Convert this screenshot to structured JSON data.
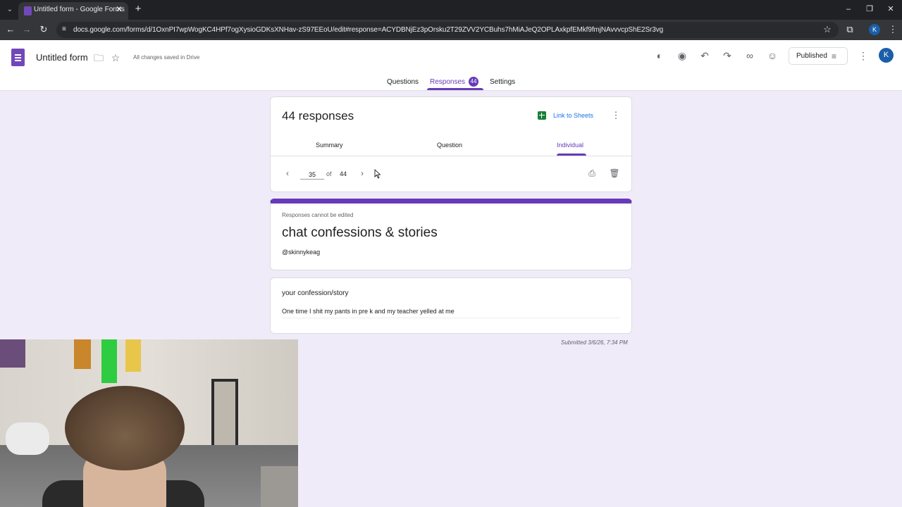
{
  "browser": {
    "tab_title": "Untitled form - Google Forms",
    "url": "docs.google.com/forms/d/1OxnPI7wpWogKC4HPf7ogXysioGDKsXNHav-zS97EEoU/edit#response=ACYDBNjEz3pOrsku2T29ZVV2YCBuhs7hMiAJeQ2OPLAxkpfEMkf9fmjNAvvvcpShE2Sr3vg",
    "profile_initial": "K"
  },
  "header": {
    "form_name": "Untitled form",
    "save_status": "All changes saved in Drive",
    "published_label": "Published",
    "avatar_initial": "K",
    "tabs": [
      {
        "label": "Questions"
      },
      {
        "label": "Responses"
      },
      {
        "label": "Settings"
      }
    ],
    "responses_count": "44"
  },
  "responses": {
    "count_label": "44 responses",
    "link_sheets": "Link to Sheets",
    "sub_tabs": [
      {
        "label": "Summary"
      },
      {
        "label": "Question"
      },
      {
        "label": "Individual"
      }
    ],
    "current_page": "35",
    "of_label": "of",
    "total": "44"
  },
  "form": {
    "notice": "Responses cannot be edited",
    "title": "chat confessions & stories",
    "description": "@skinnykeag"
  },
  "question": {
    "label": "your confession/story",
    "answer": "One time I shit my pants in pre k and my teacher yelled at me"
  },
  "submitted": "Submitted 3/6/26, 7:34 PM",
  "icons": {
    "tab_list": "chevron-down-icon",
    "back": "arrow-back-icon",
    "forward": "arrow-forward-icon",
    "reload": "reload-icon",
    "customize_theme": "palette-icon",
    "preview": "eye-icon",
    "undo": "undo-icon",
    "redo": "redo-icon",
    "link": "link-icon",
    "add_collaborator": "person-add-icon",
    "print": "print-icon",
    "delete": "trash-icon"
  },
  "colors": {
    "accent": "#673ab7",
    "background": "#f0ebf8",
    "sheets_green": "#188038",
    "link_blue": "#1a73e8"
  }
}
